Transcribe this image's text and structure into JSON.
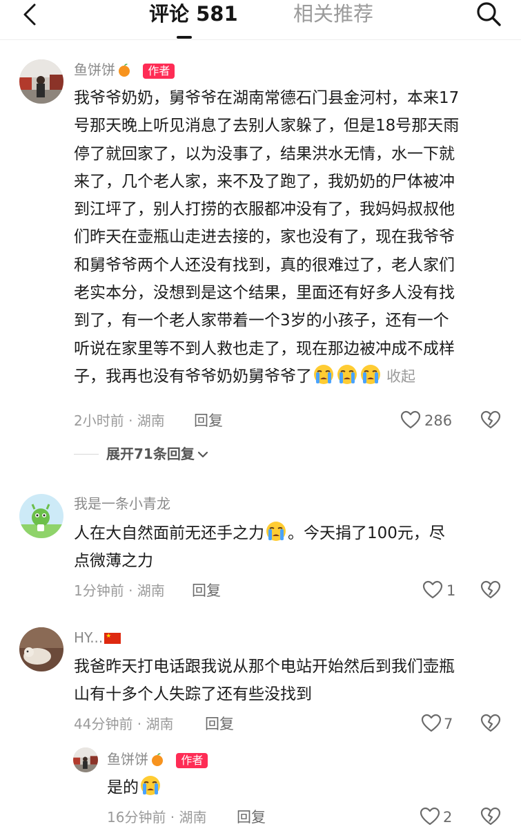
{
  "header": {
    "tab_comments": "评论 581",
    "tab_related": "相关推荐",
    "back_icon": "chevron-left-icon",
    "search_icon": "search-icon"
  },
  "comments": [
    {
      "username": "鱼饼饼",
      "badge": "作者",
      "lines": [
        "我爷爷奶奶，舅爷爷在湖南常德石门县金河村，本来17",
        "号那天晚上听见消息了去别人家躲了，但是18号那天雨",
        "停了就回家了，以为没事了，结果洪水无情，水一下就",
        "来了，几个老人家，来不及了跑了，我奶奶的尸体被冲",
        "到江坪了，别人打捞的衣服都冲没有了，我妈妈叔叔他",
        "们昨天在壶瓶山走进去接的，家也没有了，现在我爷爷",
        "和舅爷爷两个人还没有找到，真的很难过了，老人家们",
        "老实本分，没想到是这个结果，里面还有好多人没有找",
        "到了，有一个老人家带着一个3岁的小孩子，还有一个",
        "听说在家里等不到人救也走了，现在那边被冲成不成样",
        "子，我再也没有爷爷奶奶舅爷爷了"
      ],
      "collapse": "收起",
      "meta": "2小时前 · 湖南",
      "reply": "回复",
      "likes": "286",
      "expand": "展开71条回复"
    },
    {
      "username": "我是一条小青龙",
      "line1": "人在大自然面前无还手之力",
      "line1b": "。今天捐了100元，尽",
      "line2": "点微薄之力",
      "meta": "1分钟前 · 湖南",
      "reply": "回复",
      "likes": "1"
    },
    {
      "username": "HY...",
      "line1": "我爸昨天打电话跟我说从那个电站开始然后到我们壶瓶",
      "line2": "山有十多个人失踪了还有些没找到",
      "meta": "44分钟前 · 湖南",
      "reply": "回复",
      "likes": "7"
    }
  ],
  "reply_comment": {
    "username": "鱼饼饼",
    "badge": "作者",
    "text": "是的",
    "meta": "16分钟前 · 湖南",
    "reply": "回复",
    "likes": "2"
  },
  "colors": {
    "accent": "#fe2c55",
    "meta": "#9a9a9a"
  }
}
